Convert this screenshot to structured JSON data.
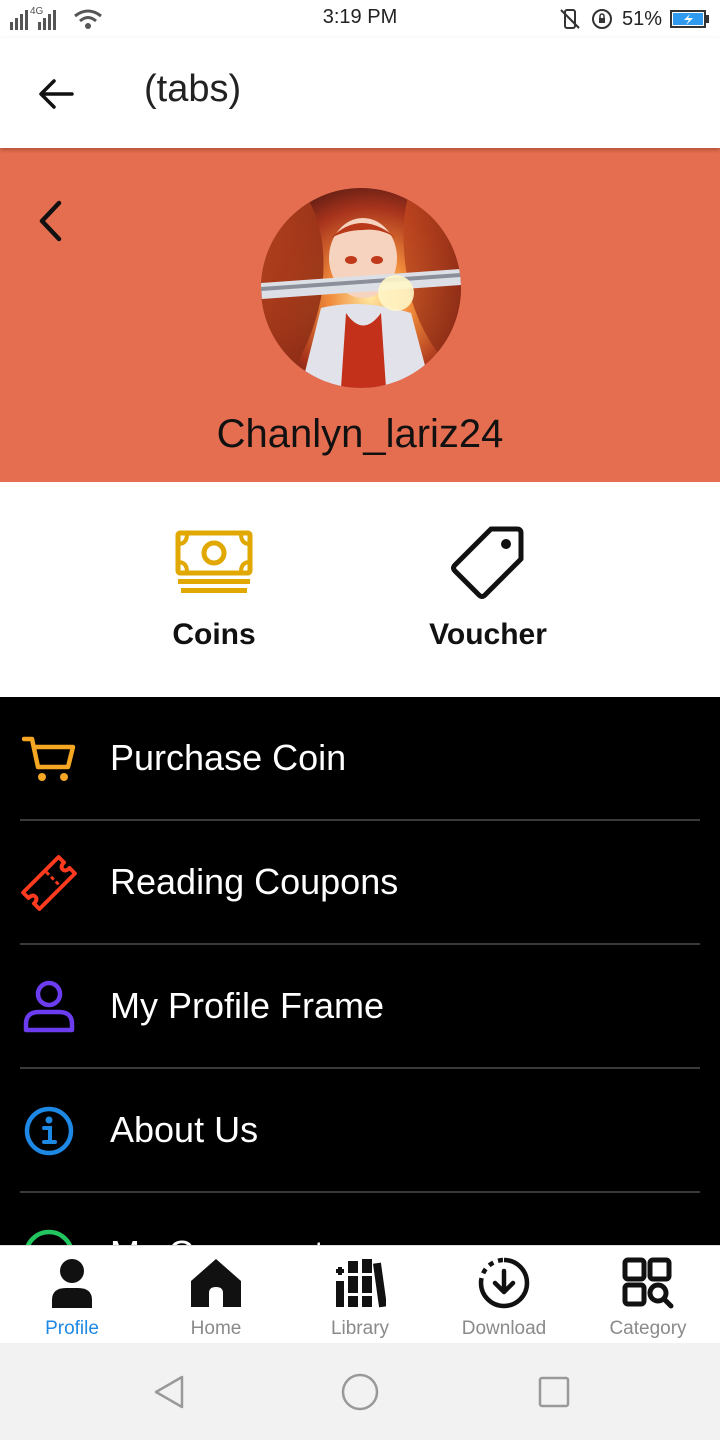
{
  "status_bar": {
    "time": "3:19 PM",
    "network": "4G",
    "battery": "51%"
  },
  "app_bar": {
    "title": "(tabs)",
    "back_icon": "arrow-left-icon"
  },
  "profile": {
    "username": "Chanlyn_lariz24",
    "back_icon": "chevron-left-icon",
    "header_color": "#e66e50"
  },
  "wallet": {
    "coins_label": "Coins",
    "voucher_label": "Voucher",
    "coins_color": "#e0a800"
  },
  "menu": {
    "items": [
      {
        "label": "Purchase Coin",
        "icon": "cart-icon",
        "color": "#f5a623"
      },
      {
        "label": "Reading Coupons",
        "icon": "ticket-icon",
        "color": "#ff3b1f"
      },
      {
        "label": "My Profile Frame",
        "icon": "user-icon",
        "color": "#6c3cf0"
      },
      {
        "label": "About Us",
        "icon": "info-icon",
        "color": "#1e88e5"
      },
      {
        "label": "My Comment",
        "icon": "comment-icon",
        "color": "#22c55e"
      }
    ]
  },
  "bottom_nav": {
    "items": [
      {
        "label": "Profile",
        "icon": "person-icon",
        "active": true
      },
      {
        "label": "Home",
        "icon": "home-icon",
        "active": false
      },
      {
        "label": "Library",
        "icon": "library-icon",
        "active": false
      },
      {
        "label": "Download",
        "icon": "download-icon",
        "active": false
      },
      {
        "label": "Category",
        "icon": "category-icon",
        "active": false
      }
    ],
    "active_color": "#1e88e5"
  },
  "system_nav": {
    "back_icon": "triangle-back-icon",
    "home_icon": "circle-home-icon",
    "recents_icon": "square-recents-icon"
  }
}
